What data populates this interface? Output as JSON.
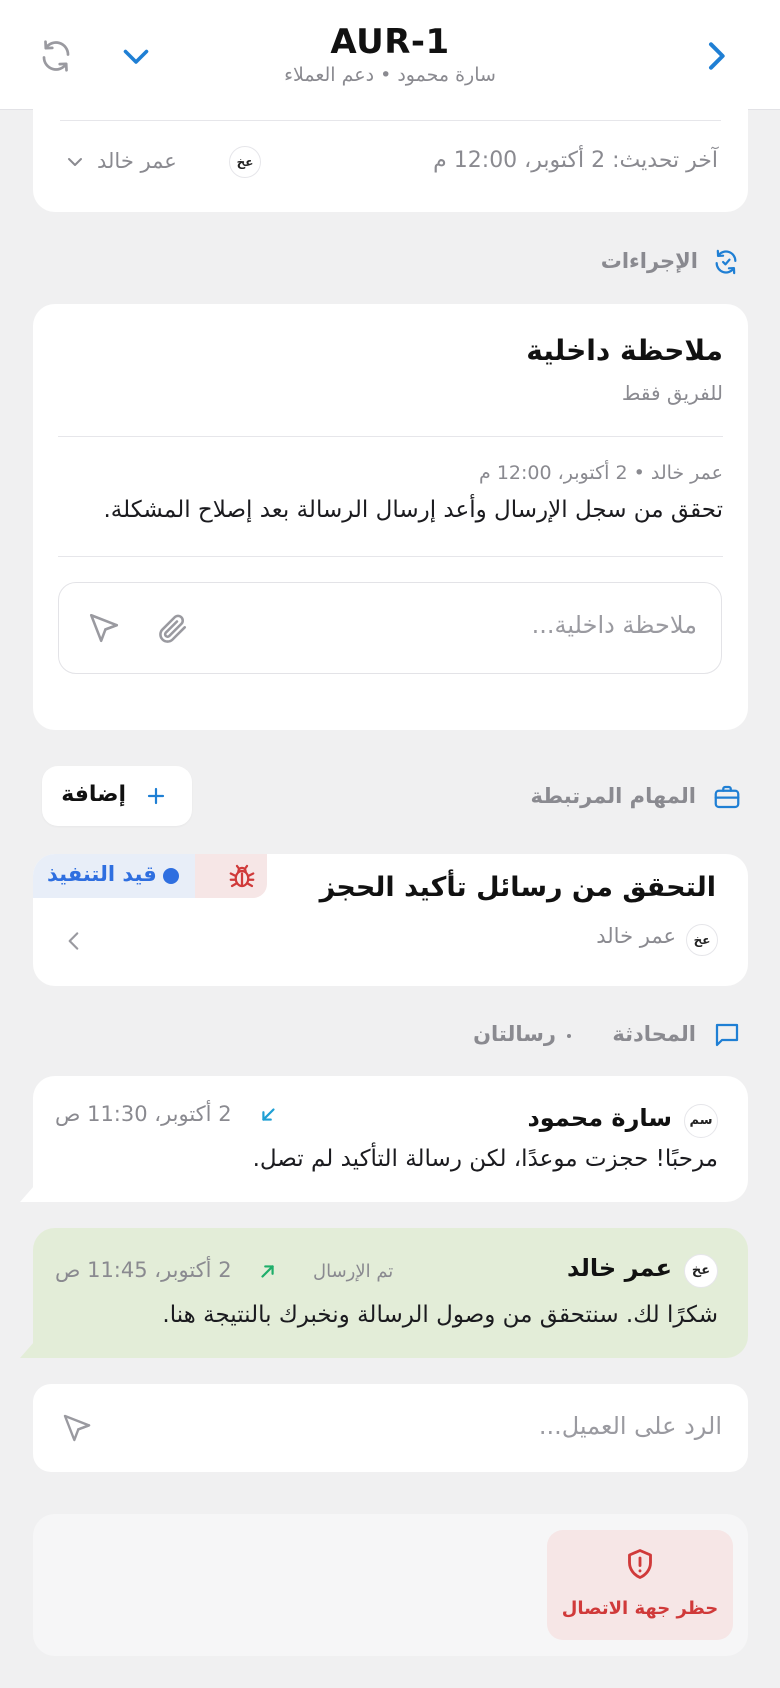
{
  "header": {
    "title": "AUR-1",
    "subtitle": "سارة محمود • دعم العملاء"
  },
  "top_card": {
    "last_update": "آخر تحديث: 2 أكتوبر، 12:00 م",
    "assignee_initials": "عخ",
    "assignee_name": "عمر خالد"
  },
  "actions_section": {
    "title": "الإجراءات"
  },
  "internal_note": {
    "title": "ملاحظة داخلية",
    "subtitle": "للفريق فقط",
    "note_meta": "عمر خالد • 2 أكتوبر، 12:00 م",
    "note_text": "تحقق من سجل الإرسال وأعد إرسال الرسالة بعد إصلاح المشكلة.",
    "input_placeholder": "ملاحظة داخلية..."
  },
  "linked_tasks": {
    "title": "المهام المرتبطة",
    "add_label": "إضافة",
    "task": {
      "title": "التحقق من رسائل تأكيد الحجز",
      "status": "قيد التنفيذ",
      "status_color": "#2f6fe0",
      "assignee_initials": "عخ",
      "assignee_name": "عمر خالد"
    }
  },
  "conversation": {
    "title": "المحادثة",
    "count": "رسالتان",
    "messages": [
      {
        "initials": "سم",
        "sender": "سارة محمود",
        "time": "2 أكتوبر، 11:30 ص",
        "text": "مرحبًا! حجزت موعدًا، لكن رسالة التأكيد لم تصل."
      },
      {
        "initials": "عخ",
        "sender": "عمر خالد",
        "status": "تم الإرسال",
        "time": "2 أكتوبر، 11:45 ص",
        "text": "شكرًا لك. سنتحقق من وصول الرسالة ونخبرك بالنتيجة هنا."
      }
    ],
    "reply_placeholder": "الرد على العميل..."
  },
  "block_contact": {
    "label": "حظر جهة الاتصال"
  },
  "colors": {
    "accent_blue": "#1f7fd4",
    "outgoing_bubble": "#e3edd8",
    "danger": "#d03a3a",
    "danger_bg": "#f6e6e6"
  }
}
